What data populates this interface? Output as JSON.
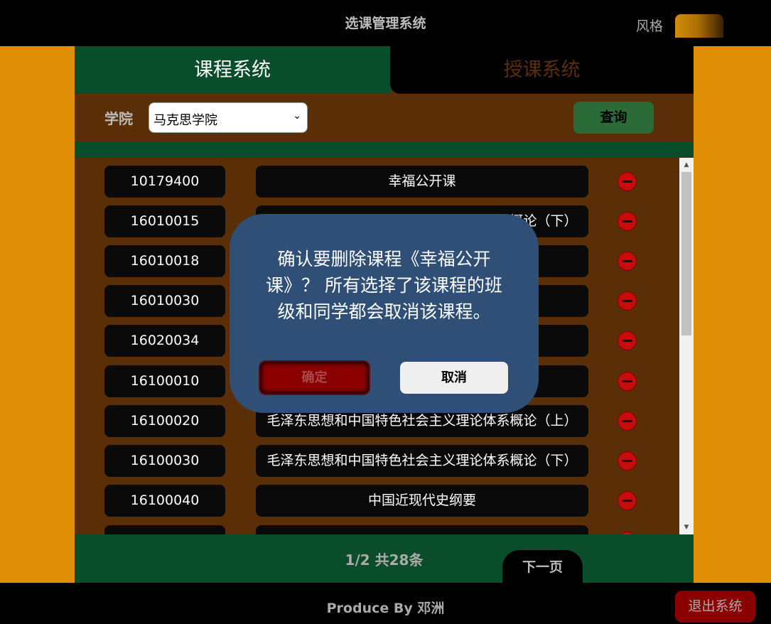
{
  "header": {
    "title": "选课管理系统",
    "style_label": "风格"
  },
  "tabs": [
    {
      "label": "课程系统",
      "active": true
    },
    {
      "label": "授课系统",
      "active": false
    }
  ],
  "filter": {
    "college_label": "学院",
    "college_selected": "马克思学院",
    "query_label": "查询"
  },
  "courses": [
    {
      "id": "10179400",
      "name": "幸福公开课"
    },
    {
      "id": "16010015",
      "name": "毛泽东思想和中国特色社会主义理论体系概论（下）"
    },
    {
      "id": "16010018",
      "name": ""
    },
    {
      "id": "16010030",
      "name": ""
    },
    {
      "id": "16020034",
      "name": ""
    },
    {
      "id": "16100010",
      "name": ""
    },
    {
      "id": "16100020",
      "name": "毛泽东思想和中国特色社会主义理论体系概论（上）"
    },
    {
      "id": "16100030",
      "name": "毛泽东思想和中国特色社会主义理论体系概论（下）"
    },
    {
      "id": "16100040",
      "name": "中国近现代史纲要"
    },
    {
      "id": "",
      "name": ""
    }
  ],
  "pagination": {
    "info": "1/2 共28条",
    "next_label": "下一页"
  },
  "footer": {
    "produce": "Produce By 邓洲",
    "logout_label": "退出系统"
  },
  "modal": {
    "message": "确认要删除课程《幸福公开课》？ 所有选择了该课程的班级和同学都会取消该课程。",
    "confirm_label": "确定",
    "cancel_label": "取消"
  },
  "colors": {
    "page_bg": "#e08e05",
    "panel_bg": "#5a2e06",
    "green": "#0a4d2b",
    "modal_bg": "#2f4f76",
    "danger": "#c80b0b"
  },
  "icons": [
    "delete-icon",
    "chevron-down-icon",
    "scroll-up-icon",
    "scroll-down-icon"
  ]
}
